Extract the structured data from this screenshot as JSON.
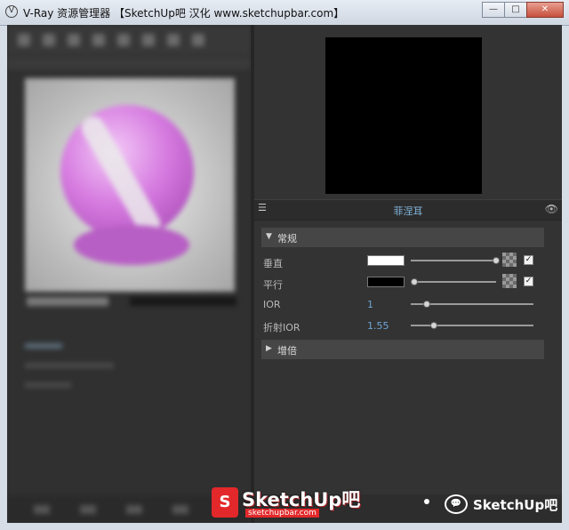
{
  "window": {
    "title": "V-Ray 资源管理器 【SketchUp吧 汉化 www.sketchupbar.com】",
    "minimize_icon": "minimize-icon",
    "maximize_icon": "maximize-icon",
    "close_icon": "close-icon",
    "minimize_glyph": "—",
    "maximize_glyph": "□",
    "close_glyph": "✕"
  },
  "right_panel": {
    "section_title": "菲涅耳",
    "list_glyph": "☰",
    "eye_glyph": "👁",
    "group_general": {
      "label": "常规",
      "arrow": "▼"
    },
    "rows": [
      {
        "label": "垂直",
        "swatch_color": "#ffffff",
        "slider": 1.0,
        "checked": true,
        "check_glyph": "✓"
      },
      {
        "label": "平行",
        "swatch_color": "#000000",
        "slider": 0.0,
        "checked": true,
        "check_glyph": "✓"
      },
      {
        "label": "IOR",
        "value": "1",
        "slider": 0.12
      },
      {
        "label": "折射IOR",
        "value": "1.55",
        "slider": 0.18
      }
    ],
    "group_gain": {
      "label": "增倍",
      "arrow": "▶"
    }
  },
  "watermark": {
    "brand": "SketchUp吧",
    "badge": "S",
    "url": "sketchupbar.com",
    "wechat_glyph": "💬",
    "wechat_text": "SketchUp吧"
  }
}
